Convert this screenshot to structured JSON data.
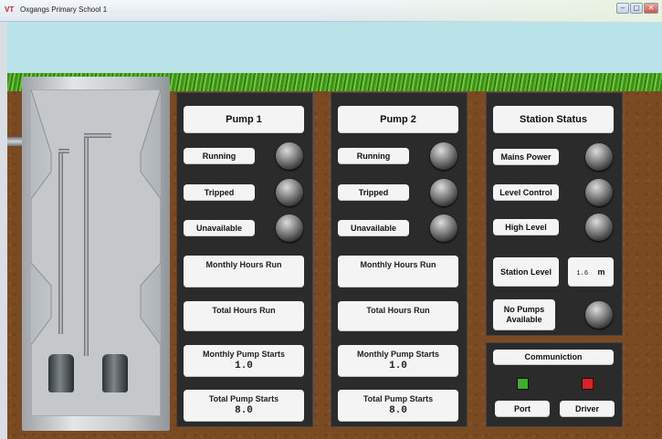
{
  "window": {
    "logo": "VT",
    "title": "Oxgangs Primary School 1",
    "buttons": [
      "–",
      "▢",
      "✕"
    ]
  },
  "pump1": {
    "title": "Pump 1",
    "indicators": [
      "Running",
      "Tripped",
      "Unavailable"
    ],
    "monthly_hours_label": "Monthly Hours Run",
    "total_hours_label": "Total Hours Run",
    "monthly_starts_label": "Monthly Pump Starts",
    "monthly_starts_value": "1.0",
    "total_starts_label": "Total Pump Starts",
    "total_starts_value": "8.0"
  },
  "pump2": {
    "title": "Pump 2",
    "indicators": [
      "Running",
      "Tripped",
      "Unavailable"
    ],
    "monthly_hours_label": "Monthly Hours Run",
    "total_hours_label": "Total Hours Run",
    "monthly_starts_label": "Monthly Pump Starts",
    "monthly_starts_value": "1.0",
    "total_starts_label": "Total Pump Starts",
    "total_starts_value": "8.0"
  },
  "station": {
    "title": "Station Status",
    "indicators": [
      "Mains Power",
      "Level Control",
      "High Level"
    ],
    "level_label": "Station Level",
    "level_value": "1.6",
    "level_unit": "m",
    "no_pumps_label_1": "No Pumps",
    "no_pumps_label_2": "Available"
  },
  "comms": {
    "title": "Communiction",
    "port_label": "Port",
    "driver_label": "Driver",
    "port_color": "#3fae2a",
    "driver_color": "#d9232a"
  },
  "colors": {
    "sky": "#b9e2e9",
    "soil": "#7a4a22",
    "panel": "#2b2b2b"
  }
}
